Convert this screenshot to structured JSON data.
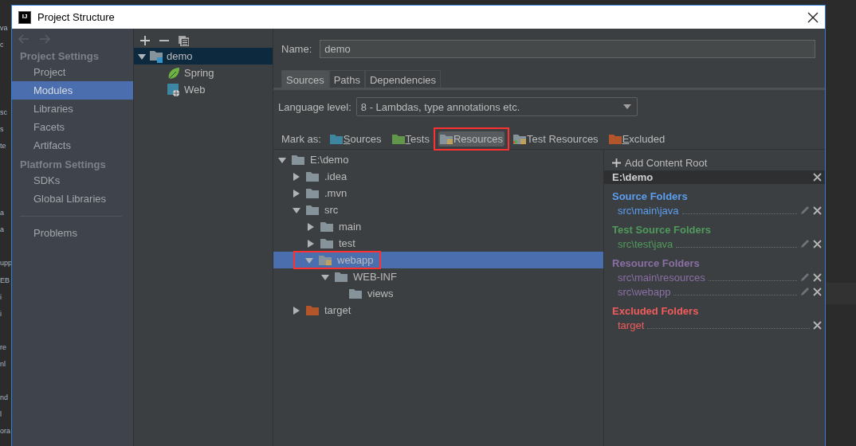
{
  "background_fragments": [
    "va",
    "c",
    "sc",
    "s",
    "te",
    "a",
    "a",
    "upp",
    "EB",
    "i",
    "i",
    "re",
    "nl",
    "nd",
    "l",
    "ora"
  ],
  "window": {
    "logo": "IJ",
    "title": "Project Structure"
  },
  "sidebar": {
    "groups": [
      {
        "heading": "Project Settings",
        "items": [
          {
            "label": "Project",
            "selected": false
          },
          {
            "label": "Modules",
            "selected": true
          },
          {
            "label": "Libraries",
            "selected": false
          },
          {
            "label": "Facets",
            "selected": false
          },
          {
            "label": "Artifacts",
            "selected": false
          }
        ]
      },
      {
        "heading": "Platform Settings",
        "items": [
          {
            "label": "SDKs",
            "selected": false
          },
          {
            "label": "Global Libraries",
            "selected": false
          }
        ]
      }
    ],
    "footer_items": [
      {
        "label": "Problems",
        "selected": false
      }
    ]
  },
  "module_tree": {
    "items": [
      {
        "label": "demo",
        "kind": "module",
        "selected": true,
        "expanded": true,
        "children": [
          {
            "label": "Spring",
            "kind": "spring",
            "selected": false
          },
          {
            "label": "Web",
            "kind": "web",
            "selected": false
          }
        ]
      }
    ]
  },
  "name_field": {
    "label": "Name:",
    "value": "demo"
  },
  "tabs": [
    {
      "label": "Sources",
      "selected": true
    },
    {
      "label": "Paths",
      "selected": false
    },
    {
      "label": "Dependencies",
      "selected": false
    }
  ],
  "language_level": {
    "label": "Language level:",
    "value": "8 - Lambdas, type annotations etc."
  },
  "mark_as": {
    "label": "Mark as:",
    "buttons": [
      {
        "label": "Sources",
        "kind": "sources",
        "mnemonic": true,
        "selected": false,
        "annotated": false
      },
      {
        "label": "Tests",
        "kind": "tests",
        "mnemonic": true,
        "selected": false,
        "annotated": false
      },
      {
        "label": "Resources",
        "kind": "resources",
        "mnemonic": false,
        "selected": true,
        "annotated": true
      },
      {
        "label": "Test Resources",
        "kind": "test_resources",
        "mnemonic": false,
        "selected": false,
        "annotated": false
      },
      {
        "label": "Excluded",
        "kind": "excluded",
        "mnemonic": true,
        "selected": false,
        "annotated": false
      }
    ]
  },
  "folder_tree": {
    "items": [
      {
        "label": "E:\\demo",
        "kind": "plain",
        "expanded": true,
        "selected": false,
        "annotated": false,
        "children": [
          {
            "label": ".idea",
            "kind": "plain",
            "expanded": false,
            "selected": false,
            "annotated": false
          },
          {
            "label": ".mvn",
            "kind": "plain",
            "expanded": false,
            "selected": false,
            "annotated": false
          },
          {
            "label": "src",
            "kind": "plain",
            "expanded": true,
            "selected": false,
            "annotated": false,
            "children": [
              {
                "label": "main",
                "kind": "plain",
                "expanded": false,
                "selected": false,
                "annotated": false
              },
              {
                "label": "test",
                "kind": "plain",
                "expanded": false,
                "selected": false,
                "annotated": false
              },
              {
                "label": "webapp",
                "kind": "resources",
                "expanded": true,
                "selected": true,
                "annotated": true,
                "children": [
                  {
                    "label": "WEB-INF",
                    "kind": "plain",
                    "expanded": true,
                    "selected": false,
                    "annotated": false,
                    "children": [
                      {
                        "label": "views",
                        "kind": "plain",
                        "selected": false,
                        "annotated": false
                      }
                    ]
                  }
                ]
              }
            ]
          },
          {
            "label": "target",
            "kind": "excluded",
            "expanded": false,
            "selected": false,
            "annotated": false
          }
        ]
      }
    ]
  },
  "content_roots": {
    "add_label": "Add Content Root",
    "root": "E:\\demo",
    "groups": [
      {
        "title": "Source Folders",
        "color": "#5c9ef0",
        "folders": [
          {
            "path": "src\\main\\java",
            "editable": true
          }
        ]
      },
      {
        "title": "Test Source Folders",
        "color": "#4f9a5c",
        "folders": [
          {
            "path": "src\\test\\java",
            "editable": true
          }
        ]
      },
      {
        "title": "Resource Folders",
        "color": "#8a6fa6",
        "folders": [
          {
            "path": "src\\main\\resources",
            "editable": true
          },
          {
            "path": "src\\webapp",
            "editable": true
          }
        ]
      },
      {
        "title": "Excluded Folders",
        "color": "#f25c5c",
        "folders": [
          {
            "path": "target",
            "editable": false
          }
        ]
      }
    ]
  }
}
